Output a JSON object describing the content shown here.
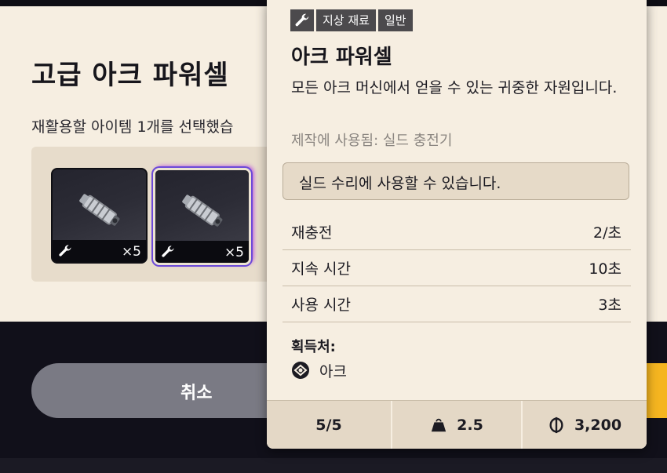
{
  "dialog": {
    "title": "고급 아크 파워셀",
    "subtitle": "재활용할 아이템 1개를 선택했습",
    "slots": [
      {
        "count": "×5",
        "selected": false
      },
      {
        "count": "×5",
        "selected": true
      }
    ],
    "cancel_label": "취소"
  },
  "tooltip": {
    "tags": [
      "지상 재료",
      "일반"
    ],
    "name": "아크 파워셀",
    "description": "모든 아크 머신에서 얻을 수 있는 귀중한 자원입니다.",
    "used_in": "제작에 사용됨: 실드 충전기",
    "note": "실드 수리에 사용할 수 있습니다.",
    "stats": [
      {
        "label": "재충전",
        "value": "2/초"
      },
      {
        "label": "지속 시간",
        "value": "10초"
      },
      {
        "label": "사용 시간",
        "value": "3초"
      }
    ],
    "source_title": "획득처:",
    "source_name": "아크",
    "footer": {
      "stack": "5/5",
      "weight": "2.5",
      "price": "3,200"
    }
  },
  "colors": {
    "panel_bg": "#f6eee1",
    "accent_yellow": "#f5b520",
    "tag_bg": "#4c4a4d"
  }
}
